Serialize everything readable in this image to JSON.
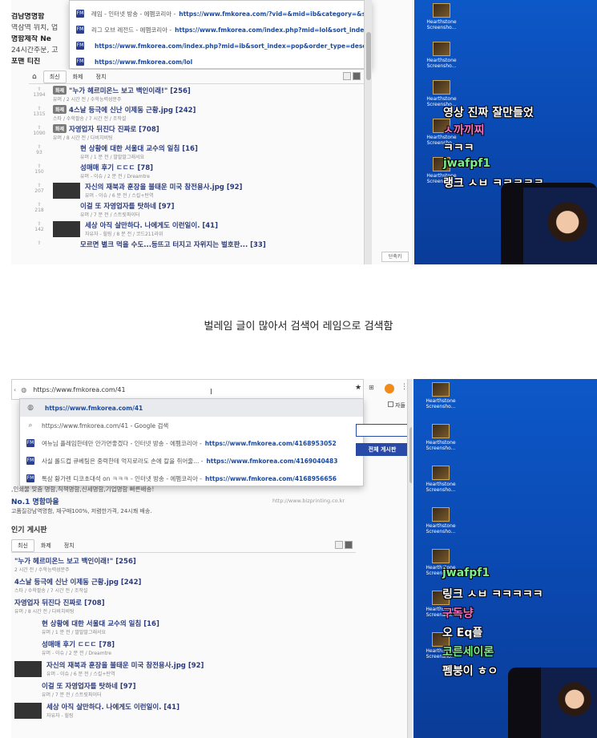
{
  "caption": "벌레임 글이 많아서 검색어 레임으로 검색함",
  "shot1": {
    "site_sidebar": [
      {
        "text": "검남명명함",
        "bold": true
      },
      {
        "text": "역삼역 위치, 업",
        "bold": false
      },
      {
        "text": "명함제작 Ne",
        "bold": true
      },
      {
        "text": "24시간주문, 고",
        "bold": false
      },
      {
        "text": "포맨 티진",
        "bold": true
      }
    ],
    "dropdown": [
      {
        "icon": "fmkorea-favicon",
        "title": "레임 - 인터넷 방송 - 에펨코리아 - ",
        "url": "https://www.fmkorea.com/?vid=&mid=ib&category=&search_keyw..."
      },
      {
        "icon": "fmkorea-favicon",
        "title": "리그 오브 레전드 - 에펨코리아 - ",
        "url": "https://www.fmkorea.com/index.php?mid=lol&sort_index=pop&orde..."
      },
      {
        "icon": "fmkorea-favicon",
        "title": "",
        "url": "https://www.fmkorea.com/index.php?mid=ib&sort_index=pop&order_type=desc&listStyle=webzine&s..."
      },
      {
        "icon": "fmkorea-favicon",
        "title": "",
        "url": "https://www.fmkorea.com/lol"
      }
    ],
    "tabs": [
      "최신",
      "화제",
      "정치"
    ],
    "posts": [
      {
        "votes": "1394",
        "badge": "화제",
        "title": "\"누가 헤르미온느 보고 백인이래!\" [256]",
        "meta": "유머 / 2 시간 전 / 수학능력성문주",
        "thumb": false
      },
      {
        "votes": "1315",
        "badge": "화제",
        "title": "4스날 등극에 신난 이제동 근황.jpg [242]",
        "meta": "스타 / 수학팔송 / 7 시간 전 / 조작설",
        "thumb": false
      },
      {
        "votes": "1090",
        "badge": "화제",
        "title": "자영업자 뒤진다 진짜로 [708]",
        "meta": "유머 / 8 시간 전 / 다비치비팅",
        "thumb": false
      },
      {
        "votes": "93",
        "badge": "",
        "title": "현 상황에 대한 서울대 교수의 일침 [16]",
        "meta": "유머 / 1 분 전 / 말말말그래서요",
        "thumb": false
      },
      {
        "votes": "150",
        "badge": "",
        "title": "성매매 후기 ㄷㄷㄷ [78]",
        "meta": "유머 - 이슈 / 2 분 전 / Dreamtre",
        "thumb": false
      },
      {
        "votes": "207",
        "badge": "",
        "title": "자신의 재북과 훈장을 불태운 미국 참전용사.jpg [92]",
        "meta": "유머 - 이슈 / 6 분 전 / 스킬+탄역",
        "thumb": true
      },
      {
        "votes": "218",
        "badge": "",
        "title": "이걸 또 자영업자를 탓하네 [97]",
        "meta": "유머 / 7 분 전 / 스트릿파이터",
        "thumb": false
      },
      {
        "votes": "142",
        "badge": "",
        "title": "세상 아직 살만하다. 나에게도 이런일이. [41]",
        "meta": "자유자 - 힐링 / 8 분 전 / 코드211라위",
        "thumb": true
      },
      {
        "votes": "",
        "badge": "",
        "title": "모르면 별크 먹을 수도...등뜨고 터지고 자위지는 벌호판... [33]",
        "meta": "",
        "thumb": false
      }
    ],
    "shortcut_label": "단축키",
    "stream_text": [
      {
        "text": "영상 진짜 잘만들었",
        "color": "#ffffff"
      },
      {
        "text": "ㅅ까끼찌",
        "color": "#ff6ec7"
      },
      {
        "text": "ㅋㅋㅋ",
        "color": "#ffffff"
      },
      {
        "text": "jwafpf1",
        "color": "#7cf08a"
      },
      {
        "text": "랭크 ㅅㅂ ㅋㅋㅋㅋㅋ",
        "color": "#ffffff"
      }
    ],
    "desktop_icons": [
      "Hearthstone Screensho...",
      "Hearthstone Screensho...",
      "Hearthstone Screensho...",
      "Hearthstone Screensho...",
      "Hearthstone Screensho..."
    ]
  },
  "shot2": {
    "omnibox_value": "https://www.fmkorea.com/41",
    "dropdown": [
      {
        "icon": "globe-icon",
        "title": "",
        "url": "https://www.fmkorea.com/41",
        "highlight": true
      },
      {
        "icon": "search-icon",
        "title": "https://www.fmkorea.com/41 - Google 검색",
        "url": "",
        "highlight": false
      },
      {
        "icon": "fmkorea-favicon",
        "title": "여뉴님 플레임한테만 안가면좋겠다 - 인터넷 방송 - 에펨코리아 - ",
        "url": "https://www.fmkorea.com/4168953052",
        "highlight": false
      },
      {
        "icon": "fmkorea-favicon",
        "title": "사실 롤드컵 큐베팀은 중력한테 억지로라도 손에 칼을 쥐어줄... - ",
        "url": "https://www.fmkorea.com/4169040483",
        "highlight": false
      },
      {
        "icon": "fmkorea-favicon",
        "title": "톡삼 황가렌 디코초대석 on ㅋㅋㅋ - 인터넷 방송 - 에펨코리아 - ",
        "url": "https://www.fmkorea.com/4168956656",
        "highlight": false
      }
    ],
    "checkbox_label": "자들",
    "search_all_label": "전체 게시판",
    "ad_lines": [
      ",인쇄물 맞춤 명함,직책명함,신세명함,기업명함 빠른배송!",
      "No.1 명함마을",
      "고품질강남역명함, 재구매100%, 저렴한가격, 24시쾌 배송.",
      "http://www.bizprinting.co.kr"
    ],
    "board_title": "인기 게시판",
    "tabs": [
      "최신",
      "화제",
      "정치"
    ],
    "posts": [
      {
        "title": "\"누가 헤르미온느 보고 백인이래!\" [256]",
        "meta": "2 시간 전 / 수학능력성문주",
        "thumb": false
      },
      {
        "title": "4스날 등극에 신난 이제동 근황.jpg [242]",
        "meta": "스타 / 수학팔송 / 7 시간 전 / 조작설",
        "thumb": false
      },
      {
        "title": "자영업자 뒤진다 진짜로 [708]",
        "meta": "유머 / 8 시간 전 / 다비치비팅",
        "thumb": false
      },
      {
        "title": "현 상황에 대한 서울대 교수의 일침 [16]",
        "meta": "유머 / 1 분 전 / 말말말그래서요",
        "thumb": false
      },
      {
        "title": "성매매 후기 ㄷㄷㄷ [78]",
        "meta": "유머 - 이슈 / 2 분 전 / Dreamtre",
        "thumb": false
      },
      {
        "title": "자신의 재북과 훈장을 불태운 미국 참전용사.jpg [92]",
        "meta": "유머 - 이슈 / 6 분 전 / 스킬+탄역",
        "thumb": true
      },
      {
        "title": "이걸 또 자영업자를 탓하네 [97]",
        "meta": "유머 / 7 분 전 / 스트릿파이터",
        "thumb": false
      },
      {
        "title": "세상 아직 살만하다. 나에게도 이런일이. [41]",
        "meta": "자유자 - 힐링",
        "thumb": true
      }
    ],
    "stream_text": [
      {
        "text": "jwafpf1",
        "color": "#7cf08a"
      },
      {
        "text": "링크 ㅅㅂ ㅋㅋㅋㅋㅋ",
        "color": "#ffffff"
      },
      {
        "text": "구독냥",
        "color": "#ff6ec7"
      },
      {
        "text": "오 Eq플",
        "color": "#ffffff"
      },
      {
        "text": "코른세이론",
        "color": "#7cf08a"
      },
      {
        "text": "펨붕이 ㅎㅇ",
        "color": "#ffffff"
      }
    ],
    "desktop_icons": [
      "Hearthstone Screensho...",
      "Hearthstone Screensho...",
      "Hearthstone Screensho...",
      "Hearthstone Screensho...",
      "Hearthstone Screensho...",
      "Hearthstone Screensho...",
      "Hearthstone Screensho..."
    ]
  }
}
